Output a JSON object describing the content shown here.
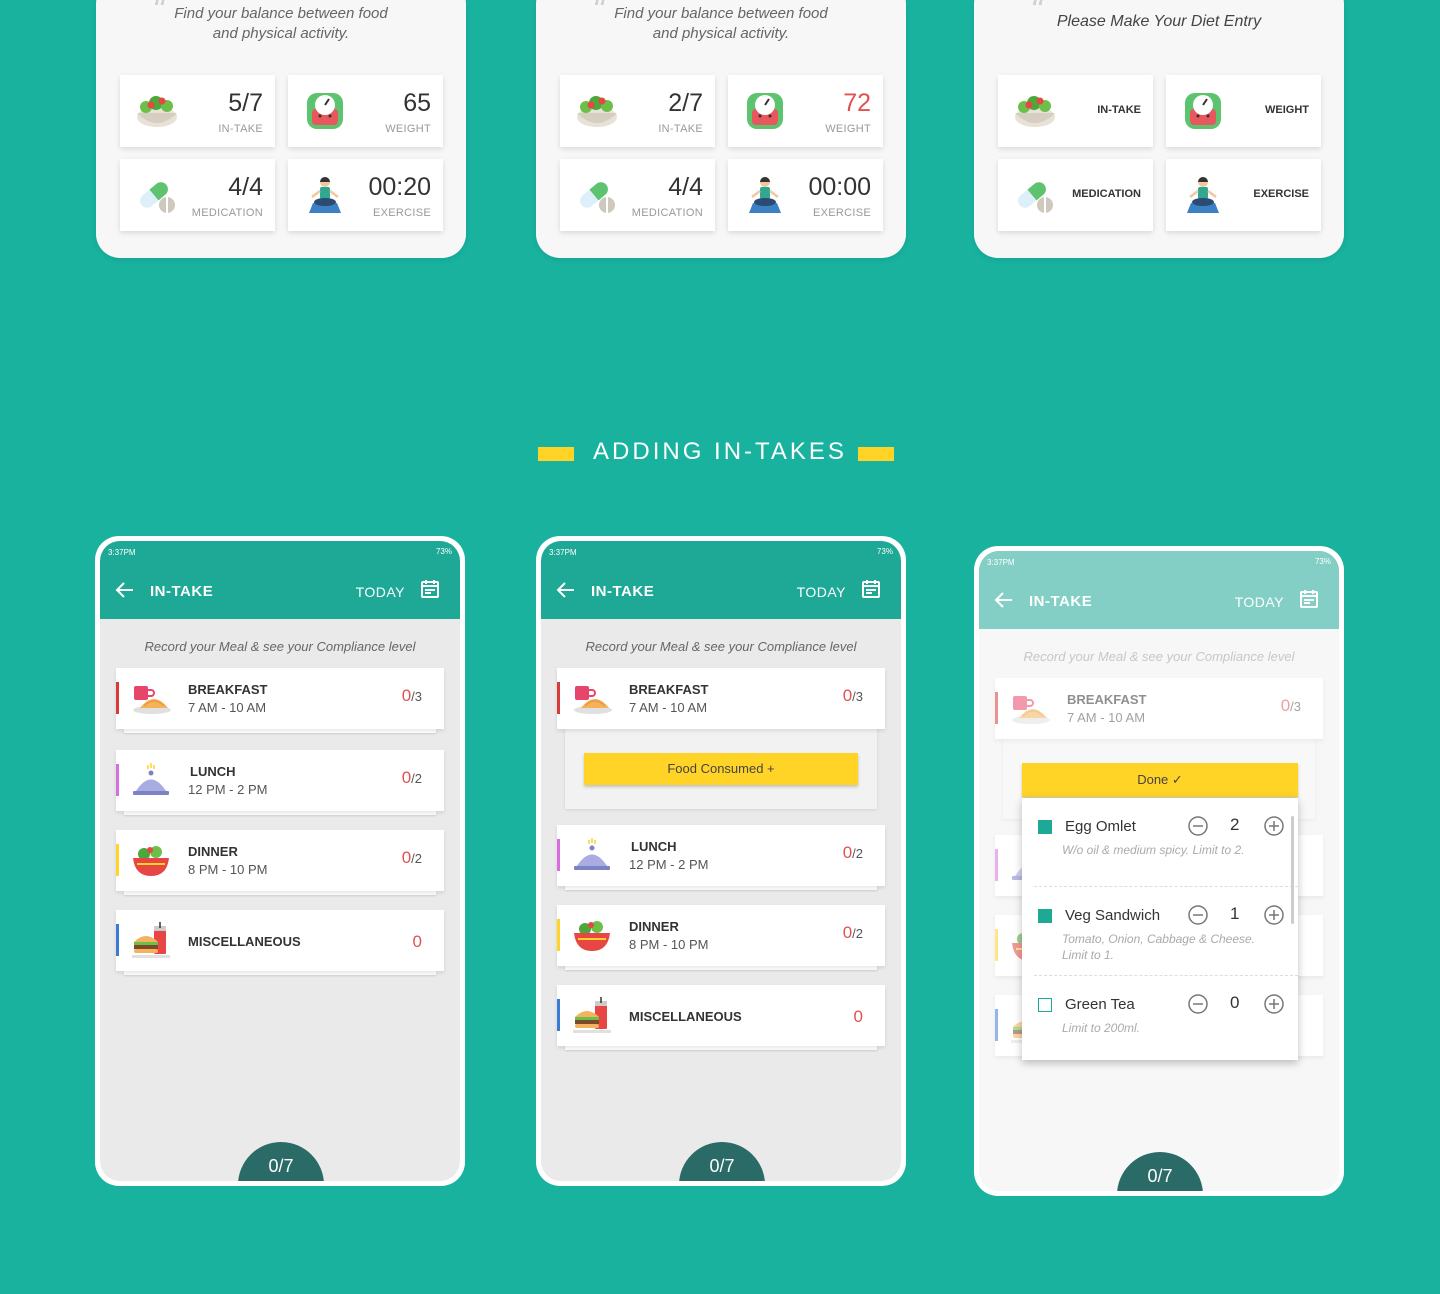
{
  "top_cards": [
    {
      "quote": [
        "Find your balance between food",
        "and physical activity."
      ],
      "tiles": [
        {
          "value": "5/7",
          "label": "IN-TAKE",
          "icon": "salad-icon"
        },
        {
          "value": "65",
          "label": "WEIGHT",
          "icon": "scale-icon"
        },
        {
          "value": "4/4",
          "label": "MEDICATION",
          "icon": "pill-icon"
        },
        {
          "value": "00:20",
          "label": "EXERCISE",
          "icon": "yoga-icon"
        }
      ]
    },
    {
      "quote": [
        "Find your balance between food",
        "and physical activity."
      ],
      "tiles": [
        {
          "value": "2/7",
          "label": "IN-TAKE",
          "icon": "salad-icon"
        },
        {
          "value": "72",
          "label": "WEIGHT",
          "icon": "scale-icon",
          "color": "#E05252"
        },
        {
          "value": "4/4",
          "label": "MEDICATION",
          "icon": "pill-icon"
        },
        {
          "value": "00:00",
          "label": "EXERCISE",
          "icon": "yoga-icon"
        }
      ]
    },
    {
      "quote": [
        "Please Make Your Diet Entry"
      ],
      "tiles": [
        {
          "label": "IN-TAKE",
          "icon": "salad-icon"
        },
        {
          "label": "WEIGHT",
          "icon": "scale-icon"
        },
        {
          "label": "MEDICATION",
          "icon": "pill-icon"
        },
        {
          "label": "EXERCISE",
          "icon": "yoga-icon"
        }
      ]
    }
  ],
  "section_title": "ADDING IN-TAKES",
  "phone": {
    "time": "3:37PM",
    "battery": "73%",
    "title": "IN-TAKE",
    "today": "TODAY",
    "subtitle": "Record your Meal & see your Compliance level",
    "total": "0/7"
  },
  "meals": [
    {
      "name": "BREAKFAST",
      "time": "7 AM - 10 AM",
      "done": "0",
      "of": "/3",
      "stripe": "#D93A3A",
      "icon": "breakfast-icon"
    },
    {
      "name": "LUNCH",
      "time": "12 PM - 2 PM",
      "done": "0",
      "of": "/2",
      "stripe": "#D86DE0",
      "icon": "cloche-icon"
    },
    {
      "name": "DINNER",
      "time": "8 PM - 10 PM",
      "done": "0",
      "of": "/2",
      "stripe": "#FFD426",
      "icon": "bowl-icon"
    },
    {
      "name": "MISCELLANEOUS",
      "time": "",
      "done": "0",
      "of": "",
      "stripe": "#3A7BD5",
      "icon": "burger-icon"
    }
  ],
  "food_consumed_label": "Food Consumed +",
  "done_label": "Done ✓",
  "popup_items": [
    {
      "name": "Egg Omlet",
      "desc": "W/o oil & medium spicy. Limit to 2.",
      "qty": "2",
      "checked": true
    },
    {
      "name": "Veg Sandwich",
      "desc": "Tomato, Onion, Cabbage & Cheese. Limit to 1.",
      "qty": "1",
      "checked": true
    },
    {
      "name": "Green Tea",
      "desc": "Limit to 200ml.",
      "qty": "0",
      "checked": false
    }
  ],
  "colors": {
    "background": "#18B29F",
    "app_bar": "#1EA896",
    "accent_yellow": "#FFD426",
    "count_red": "#E05252",
    "bottom_tab": "#2A6B67"
  }
}
